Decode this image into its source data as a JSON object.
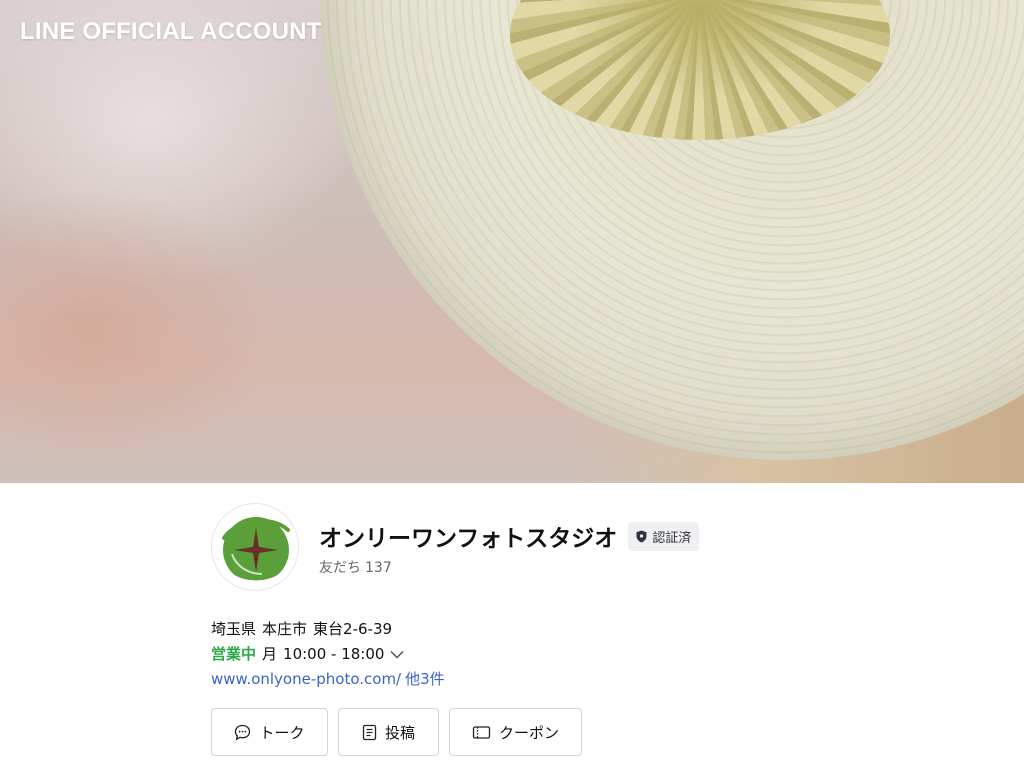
{
  "brand": {
    "label": "LINE OFFICIAL ACCOUNT"
  },
  "profile": {
    "name": "オンリーワンフォトスタジオ",
    "verified_label": "認証済",
    "friends_label": "友だち",
    "friends_count": "137"
  },
  "info": {
    "address": {
      "prefecture": "埼玉県",
      "city": "本庄市",
      "street": "東台2-6-39"
    },
    "hours": {
      "status": "営業中",
      "day": "月",
      "time": "10:00 - 18:00"
    },
    "website": {
      "url": "www.onlyone-photo.com/",
      "more": "他3件"
    }
  },
  "actions": [
    {
      "label": "トーク",
      "icon": "chat-bubble-icon"
    },
    {
      "label": "投稿",
      "icon": "post-icon"
    },
    {
      "label": "クーポン",
      "icon": "coupon-icon"
    }
  ],
  "colors": {
    "open_status": "#2fa84a",
    "link": "#3a64c8",
    "avatar_green": "#5a9f3a",
    "avatar_star": "#6b2f27"
  }
}
